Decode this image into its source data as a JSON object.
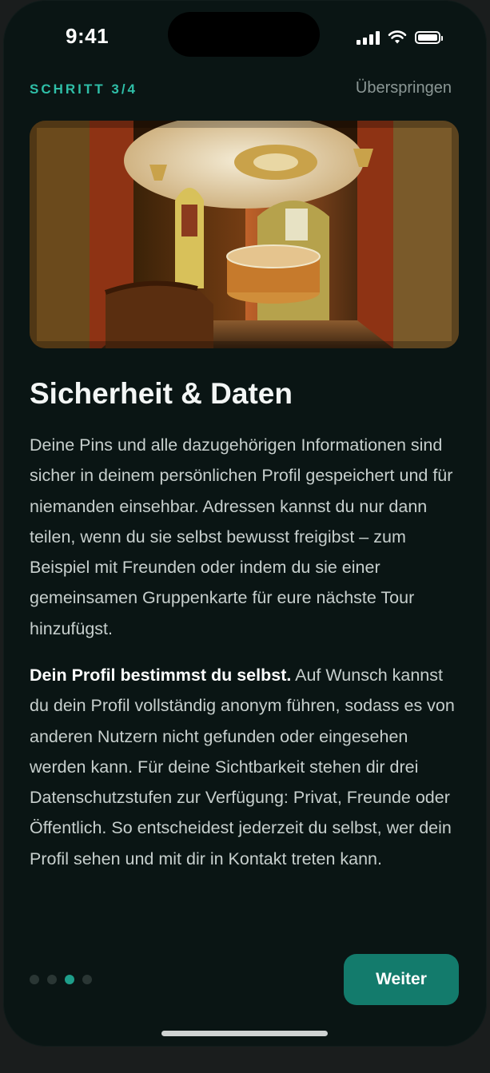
{
  "status_bar": {
    "time": "9:41"
  },
  "header": {
    "step": "SCHRITT 3/4",
    "skip": "Überspringen"
  },
  "content": {
    "title": "Sicherheit & Daten",
    "paragraph1": "Deine Pins und alle dazugehörigen Informationen sind sicher in deinem persönlichen Profil gespeichert und für niemanden einsehbar. Adressen kannst du nur dann teilen, wenn du sie selbst bewusst freigibst – zum Beispiel mit Freunden oder indem du sie einer gemeinsamen Gruppenkarte für eure nächste Tour hinzufügst.",
    "paragraph2_bold": "Dein Profil bestimmst du selbst.",
    "paragraph2_rest": " Auf Wunsch kannst du dein Profil vollständig anonym führen, sodass es von anderen Nutzern nicht gefunden oder eingesehen werden kann. Für deine Sichtbarkeit stehen dir drei Datenschutzstufen zur Verfügung: Privat, Freunde oder Öffentlich. So entscheidest jederzeit du selbst, wer dein Profil sehen und mit dir in Kontakt treten kann."
  },
  "footer": {
    "pagination": {
      "total": 4,
      "current": 3
    },
    "next_button": "Weiter"
  },
  "colors": {
    "accent": "#2fbfa8",
    "button": "#137b6c",
    "background": "#0a1514"
  }
}
